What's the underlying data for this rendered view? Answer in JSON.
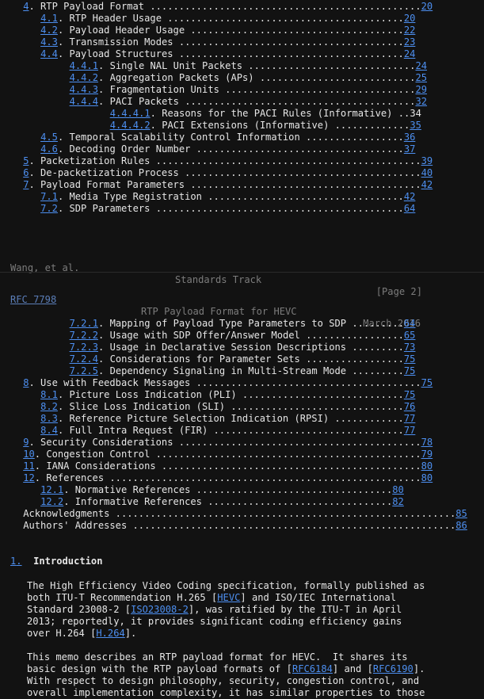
{
  "toc1": [
    {
      "indent": 4,
      "num": "4",
      "title": "RTP Payload Format",
      "dots": "...............................................",
      "page": "20",
      "page_linked": true
    },
    {
      "indent": 7,
      "num": "4.1",
      "title": "RTP Header Usage",
      "dots": ".........................................",
      "page": "20",
      "page_linked": true
    },
    {
      "indent": 7,
      "num": "4.2",
      "title": "Payload Header Usage",
      "dots": ".....................................",
      "page": "22",
      "page_linked": true
    },
    {
      "indent": 7,
      "num": "4.3",
      "title": "Transmission Modes",
      "dots": ".......................................",
      "page": "23",
      "page_linked": true
    },
    {
      "indent": 7,
      "num": "4.4",
      "title": "Payload Structures",
      "dots": ".......................................",
      "page": "24",
      "page_linked": true
    },
    {
      "indent": 12,
      "num": "4.4.1",
      "title": "Single NAL Unit Packets",
      "dots": ".............................",
      "page": "24",
      "page_linked": true
    },
    {
      "indent": 12,
      "num": "4.4.2",
      "title": "Aggregation Packets (APs)",
      "dots": "...........................",
      "page": "25",
      "page_linked": true
    },
    {
      "indent": 12,
      "num": "4.4.3",
      "title": "Fragmentation Units",
      "dots": ".................................",
      "page": "29",
      "page_linked": true
    },
    {
      "indent": 12,
      "num": "4.4.4",
      "title": "PACI Packets",
      "dots": "........................................",
      "page": "32",
      "page_linked": true
    },
    {
      "indent": 19,
      "num": "4.4.4.1",
      "title": "Reasons for the PACI Rules (Informative)",
      "dots": "..",
      "page": "34",
      "page_linked": false
    },
    {
      "indent": 19,
      "num": "4.4.4.2",
      "title": "PACI Extensions (Informative)",
      "dots": ".............",
      "page": "35",
      "page_linked": true
    },
    {
      "indent": 7,
      "num": "4.5",
      "title": "Temporal Scalability Control Information",
      "dots": ".................",
      "page": "36",
      "page_linked": true
    },
    {
      "indent": 7,
      "num": "4.6",
      "title": "Decoding Order Number",
      "dots": "....................................",
      "page": "37",
      "page_linked": true
    },
    {
      "indent": 4,
      "num": "5",
      "title": "Packetization Rules",
      "dots": "..............................................",
      "page": "39",
      "page_linked": true
    },
    {
      "indent": 4,
      "num": "6",
      "title": "De-packetization Process",
      "dots": ".........................................",
      "page": "40",
      "page_linked": true
    },
    {
      "indent": 4,
      "num": "7",
      "title": "Payload Format Parameters",
      "dots": "........................................",
      "page": "42",
      "page_linked": true
    },
    {
      "indent": 7,
      "num": "7.1",
      "title": "Media Type Registration",
      "dots": "..................................",
      "page": "42",
      "page_linked": true
    },
    {
      "indent": 7,
      "num": "7.2",
      "title": "SDP Parameters",
      "dots": "...........................................",
      "page": "64",
      "page_linked": true
    }
  ],
  "footer": {
    "left": "Wang, et al.",
    "center": "Standards Track",
    "right": "[Page 2]"
  },
  "running_header": {
    "rfc_link": "RFC 7798",
    "center": "RTP Payload Format for HEVC",
    "right": "March 2016"
  },
  "toc2": [
    {
      "indent": 12,
      "num": "7.2.1",
      "title": "Mapping of Payload Type Parameters to SDP",
      "dots": ".........",
      "page": "64",
      "page_linked": true
    },
    {
      "indent": 12,
      "num": "7.2.2",
      "title": "Usage with SDP Offer/Answer Model",
      "dots": ".................",
      "page": "65",
      "page_linked": true
    },
    {
      "indent": 12,
      "num": "7.2.3",
      "title": "Usage in Declarative Session Descriptions",
      "dots": ".........",
      "page": "73",
      "page_linked": true
    },
    {
      "indent": 12,
      "num": "7.2.4",
      "title": "Considerations for Parameter Sets",
      "dots": ".................",
      "page": "75",
      "page_linked": true
    },
    {
      "indent": 12,
      "num": "7.2.5",
      "title": "Dependency Signaling in Multi-Stream Mode",
      "dots": ".........",
      "page": "75",
      "page_linked": true
    },
    {
      "indent": 4,
      "num": "8",
      "title": "Use with Feedback Messages",
      "dots": ".......................................",
      "page": "75",
      "page_linked": true
    },
    {
      "indent": 7,
      "num": "8.1",
      "title": "Picture Loss Indication (PLI)",
      "dots": "............................",
      "page": "75",
      "page_linked": true
    },
    {
      "indent": 7,
      "num": "8.2",
      "title": "Slice Loss Indication (SLI)",
      "dots": "..............................",
      "page": "76",
      "page_linked": true
    },
    {
      "indent": 7,
      "num": "8.3",
      "title": "Reference Picture Selection Indication (RPSI)",
      "dots": "............",
      "page": "77",
      "page_linked": true
    },
    {
      "indent": 7,
      "num": "8.4",
      "title": "Full Intra Request (FIR)",
      "dots": ".................................",
      "page": "77",
      "page_linked": true
    },
    {
      "indent": 4,
      "num": "9",
      "title": "Security Considerations",
      "dots": "..........................................",
      "page": "78",
      "page_linked": true
    },
    {
      "indent": 4,
      "num": "10",
      "title": "Congestion Control",
      "dots": "..............................................",
      "page": "79",
      "page_linked": true
    },
    {
      "indent": 4,
      "num": "11",
      "title": "IANA Considerations",
      "dots": ".............................................",
      "page": "80",
      "page_linked": true
    },
    {
      "indent": 4,
      "num": "12",
      "title": "References",
      "dots": "......................................................",
      "page": "80",
      "page_linked": true
    },
    {
      "indent": 7,
      "num": "12.1",
      "title": "Normative References",
      "dots": "..................................",
      "page": "80",
      "page_linked": true
    },
    {
      "indent": 7,
      "num": "12.2",
      "title": "Informative References",
      "dots": "................................",
      "page": "82",
      "page_linked": true
    },
    {
      "indent": 4,
      "num": "",
      "title": "Acknowledgments",
      "dots": "...........................................................",
      "page": "85",
      "page_linked": true
    },
    {
      "indent": 4,
      "num": "",
      "title": "Authors' Addresses",
      "dots": "........................................................",
      "page": "86",
      "page_linked": true
    }
  ],
  "section": {
    "num": "1",
    "title": "Introduction"
  },
  "para1": [
    [
      {
        "t": "The High Efficiency Video Coding specification, formally published as"
      }
    ],
    [
      {
        "t": "both ITU-T Recommendation H.265 ["
      },
      {
        "t": "HEVC",
        "link": true
      },
      {
        "t": "] and ISO/IEC International"
      }
    ],
    [
      {
        "t": "Standard 23008-2 ["
      },
      {
        "t": "ISO23008-2",
        "link": true
      },
      {
        "t": "], was ratified by the ITU-T in April"
      }
    ],
    [
      {
        "t": "2013; reportedly, it provides significant coding efficiency gains"
      }
    ],
    [
      {
        "t": "over H.264 ["
      },
      {
        "t": "H.264",
        "link": true
      },
      {
        "t": "]."
      }
    ]
  ],
  "para2": [
    [
      {
        "t": "This memo describes an RTP payload format for HEVC.  It shares its"
      }
    ],
    [
      {
        "t": "basic design with the RTP payload formats of ["
      },
      {
        "t": "RFC6184",
        "link": true
      },
      {
        "t": "] and ["
      },
      {
        "t": "RFC6190",
        "link": true
      },
      {
        "t": "]."
      }
    ],
    [
      {
        "t": "With respect to design philosophy, security, congestion control, and"
      }
    ],
    [
      {
        "t": "overall implementation complexity, it has similar properties to those"
      }
    ]
  ]
}
